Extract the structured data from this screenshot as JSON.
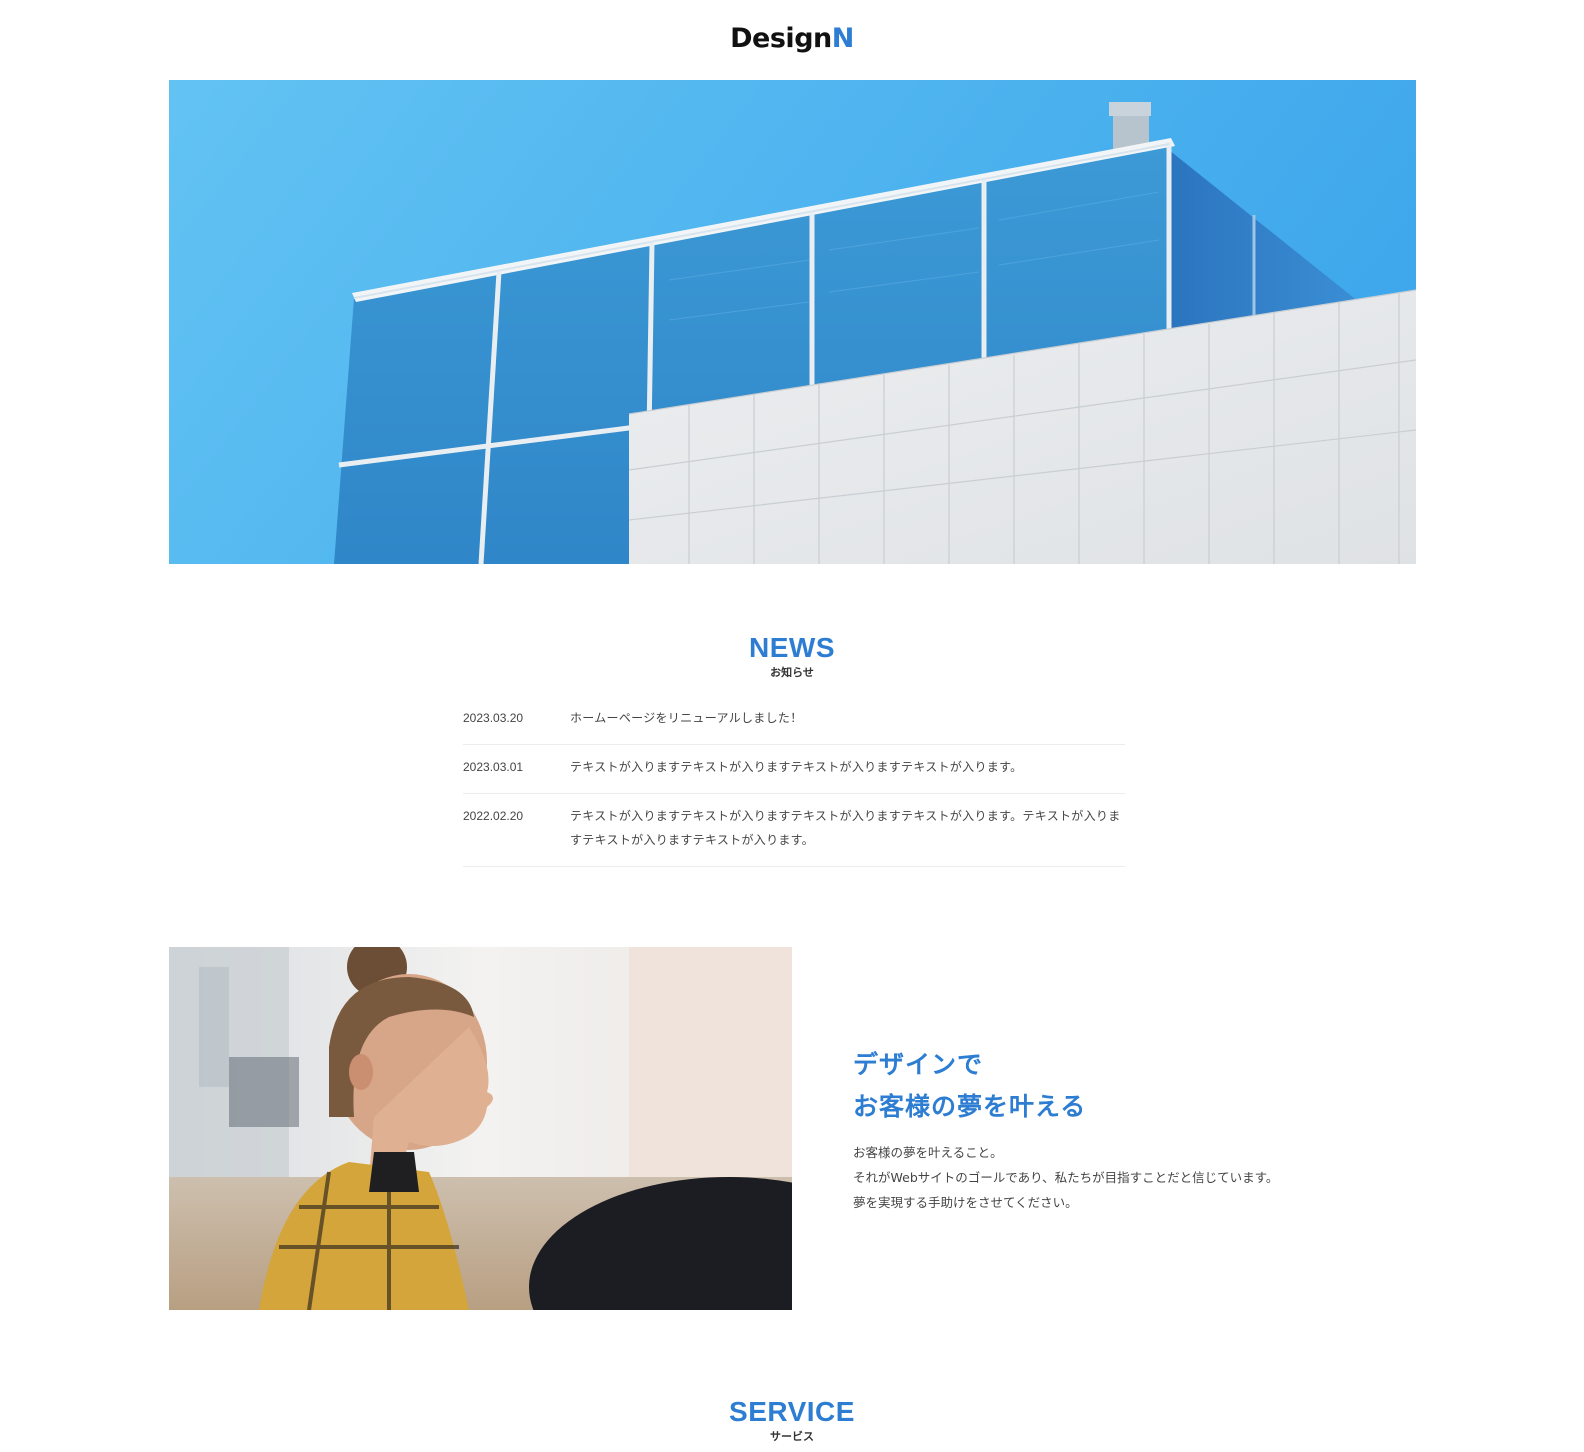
{
  "header": {
    "logo_main": "Design",
    "logo_accent": "N"
  },
  "colors": {
    "accent": "#2d7dd2",
    "text": "#333333",
    "divider": "#ececec"
  },
  "news": {
    "title": "NEWS",
    "subtitle": "お知らせ",
    "items": [
      {
        "date": "2023.03.20",
        "text": "ホームーページをリニューアルしました！"
      },
      {
        "date": "2023.03.01",
        "text": "テキストが入りますテキストが入りますテキストが入りますテキストが入ります。"
      },
      {
        "date": "2022.02.20",
        "text": "テキストが入りますテキストが入りますテキストが入りますテキストが入ります。テキストが入りますテキストが入りますテキストが入ります。"
      }
    ]
  },
  "about": {
    "title_line1": "デザインで",
    "title_line2": "お客様の夢を叶える",
    "text_lines": [
      "お客様の夢を叶えること。",
      "それがWebサイトのゴールであり、私たちが目指すことだと信じています。",
      "夢を実現する手助けをさせてください。"
    ]
  },
  "service": {
    "title": "SERVICE",
    "subtitle": "サービス"
  }
}
